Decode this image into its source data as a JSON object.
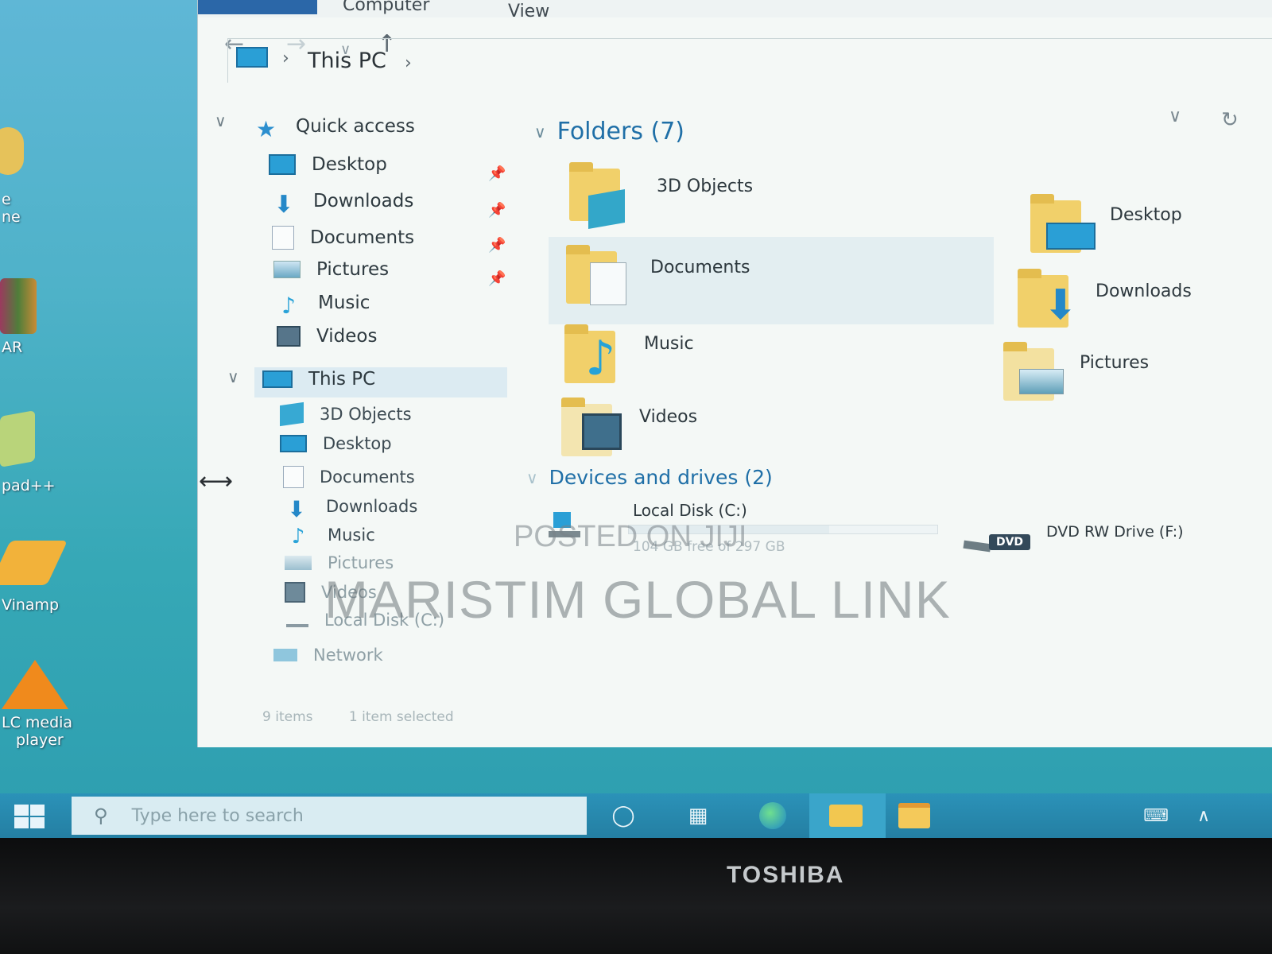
{
  "desktop": {
    "icons": [
      {
        "label": "e",
        "label2": "ne"
      },
      {
        "label": "AR"
      },
      {
        "label": "pad++"
      },
      {
        "label": "Vinamp"
      },
      {
        "label": "LC media",
        "label2": "player"
      }
    ]
  },
  "explorer": {
    "ribbon": {
      "tab_computer": "Computer",
      "tab_view": "View"
    },
    "breadcrumb": {
      "location": "This PC"
    },
    "nav": {
      "quick_access": "Quick access",
      "quick_items": [
        "Desktop",
        "Downloads",
        "Documents",
        "Pictures",
        "Music",
        "Videos"
      ],
      "this_pc": "This PC",
      "pc_items": [
        "3D Objects",
        "Desktop",
        "Documents",
        "Downloads",
        "Music",
        "Pictures",
        "Videos",
        "Local Disk (C:)"
      ],
      "network": "Network"
    },
    "folders_header": "Folders (7)",
    "folders": [
      "3D Objects",
      "Documents",
      "Music",
      "Videos",
      "Desktop",
      "Downloads",
      "Pictures"
    ],
    "devices_header": "Devices and drives (2)",
    "drives": {
      "local_disk": "Local Disk (C:)",
      "local_disk_space": "104 GB free of 297 GB",
      "dvd": "DVD RW Drive (F:)",
      "dvd_badge": "DVD"
    },
    "status": {
      "items": "9 items",
      "selected": "1 item selected"
    }
  },
  "taskbar": {
    "search_placeholder": "Type here to search"
  },
  "bezel": {
    "brand": "TOSHIBA"
  },
  "watermark": {
    "line1": "POSTED ON JIJI",
    "line2": "MARISTIM GLOBAL LINK"
  },
  "colors": {
    "accent": "#1f6fa7",
    "folder": "#f1d06a",
    "taskbar": "#247fa3"
  }
}
